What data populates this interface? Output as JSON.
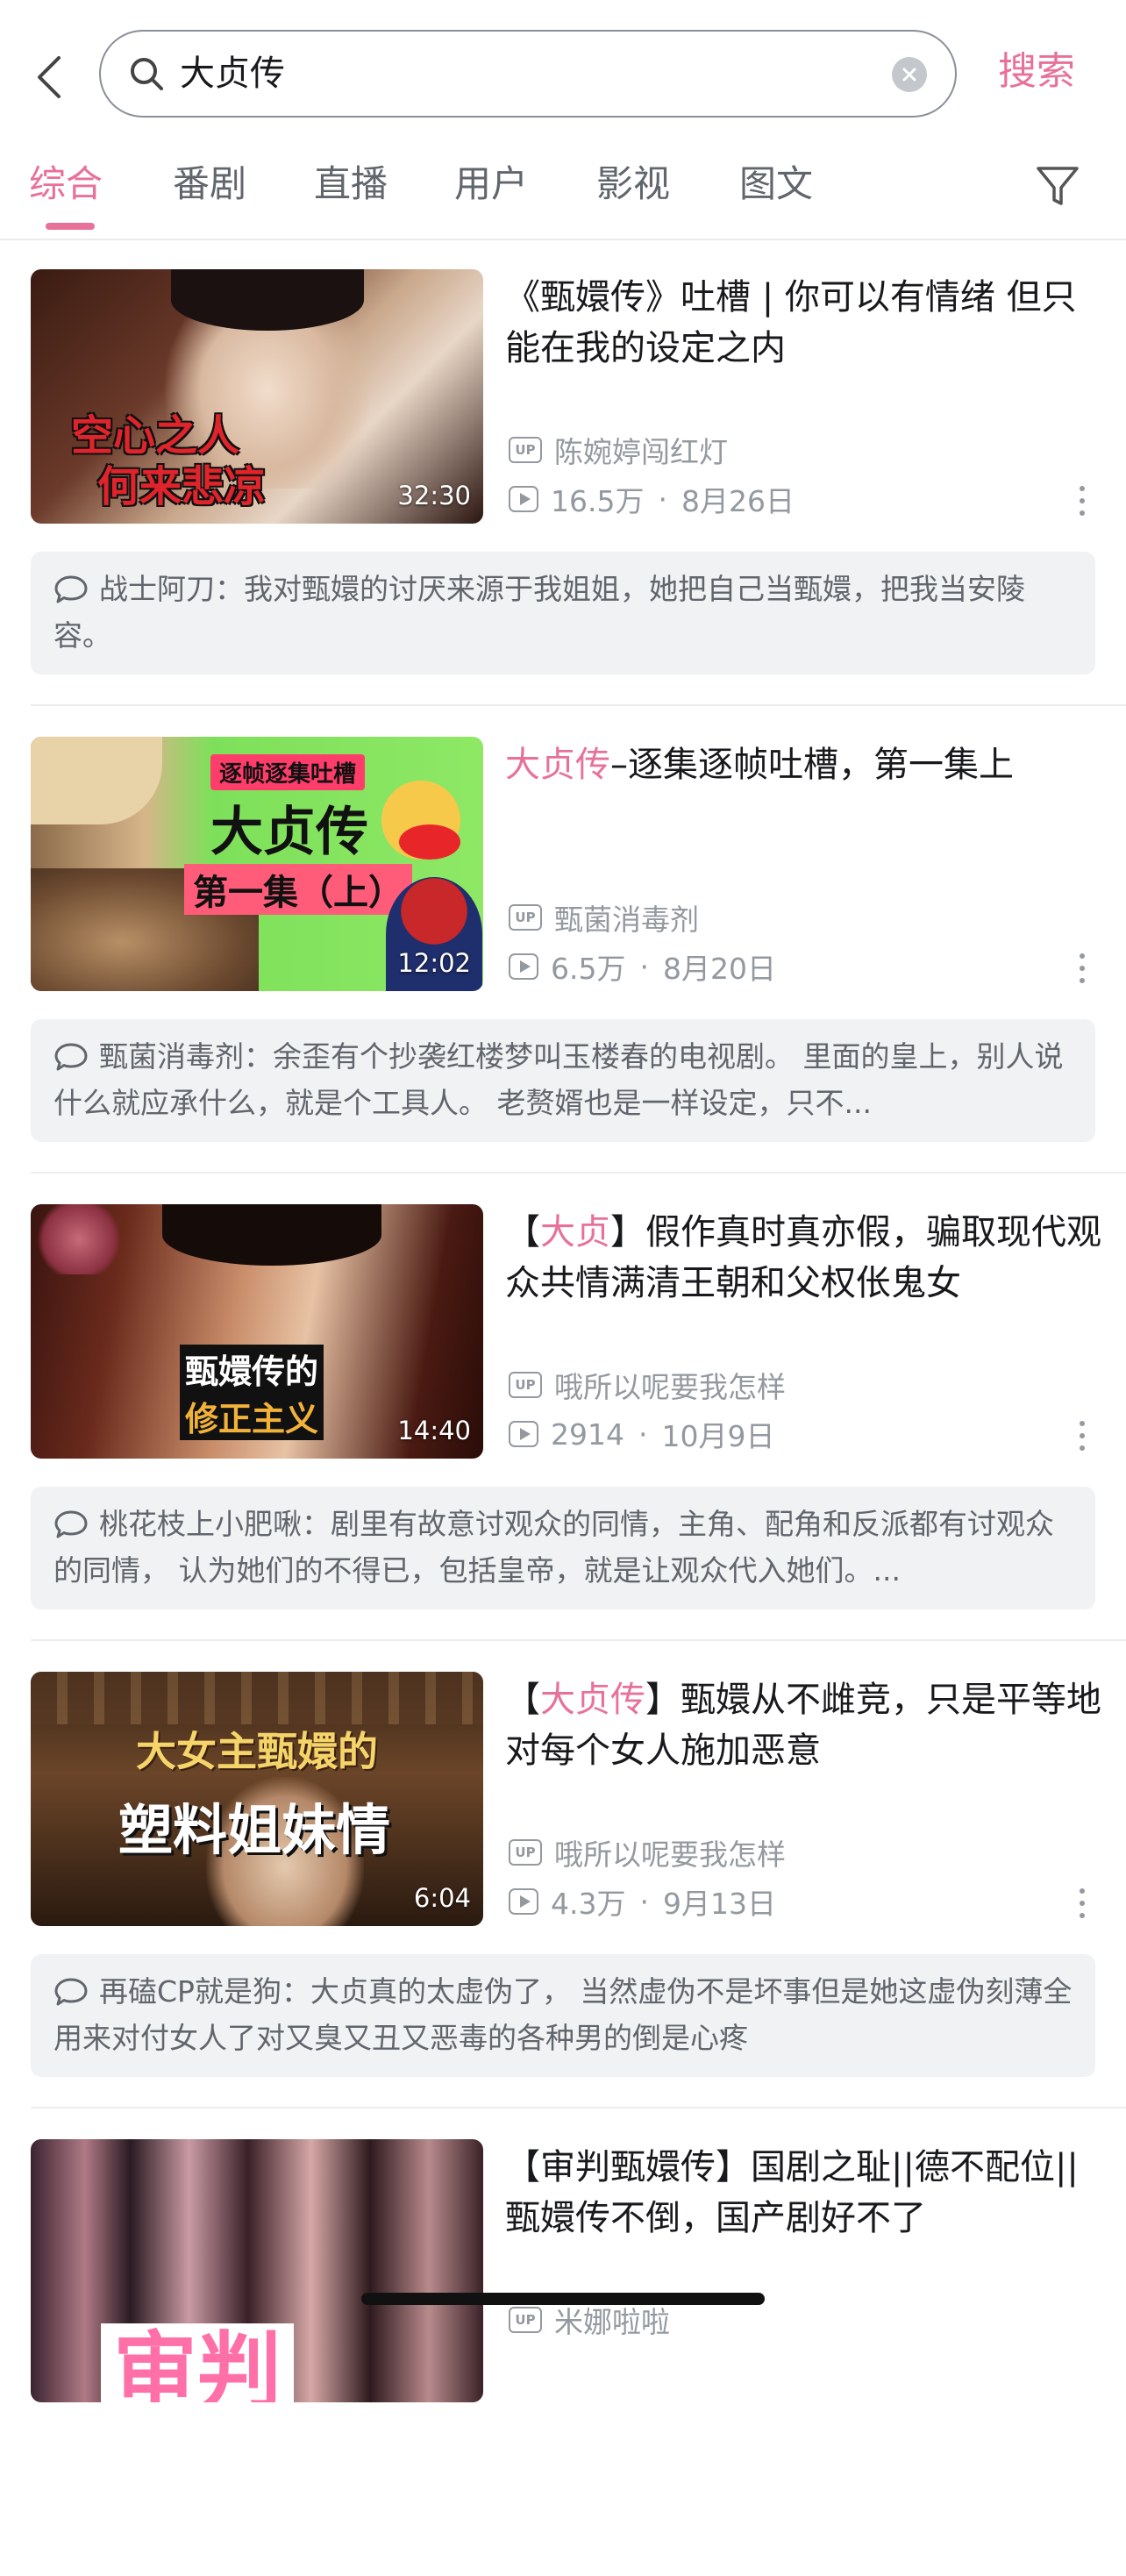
{
  "search": {
    "query": "大贞传",
    "search_button": "搜索"
  },
  "tabs": [
    {
      "label": "综合",
      "active": true
    },
    {
      "label": "番剧",
      "active": false
    },
    {
      "label": "直播",
      "active": false
    },
    {
      "label": "用户",
      "active": false
    },
    {
      "label": "影视",
      "active": false
    },
    {
      "label": "图文",
      "active": false
    }
  ],
  "colors": {
    "accent": "#e8719a",
    "text_secondary": "#9499a0",
    "comment_bg": "#f1f2f3"
  },
  "results": [
    {
      "title_prefix": "",
      "title_highlight": "",
      "title_suffix": "《甄嬛传》吐槽 | 你可以有情绪 但只能在我的设定之内",
      "thumb_text_1": "空心之人",
      "thumb_text_2": "何来悲凉",
      "duration": "32:30",
      "uploader": "陈婉婷闯红灯",
      "views": "16.5万",
      "date": "8月26日",
      "comment": "战士阿刀：我对甄嬛的讨厌来源于我姐姐，她把自己当甄嬛，把我当安陵容。"
    },
    {
      "title_prefix": "",
      "title_highlight": "大贞传",
      "title_suffix": "–逐集逐帧吐槽，第一集上",
      "thumb_text_1": "逐帧逐集吐槽",
      "thumb_text_2": "大贞传",
      "thumb_text_3": "第一集（上）",
      "duration": "12:02",
      "uploader": "甄菌消毒剂",
      "views": "6.5万",
      "date": "8月20日",
      "comment": "甄菌消毒剂：余歪有个抄袭红楼梦叫玉楼春的电视剧。 里面的皇上，别人说什么就应承什么，就是个工具人。 老赘婿也是一样设定，只不..."
    },
    {
      "title_prefix": "【",
      "title_highlight": "大贞",
      "title_suffix": "】假作真时真亦假，骗取现代观众共情满清王朝和父权伥鬼女",
      "thumb_text_1": "甄嬛传的",
      "thumb_text_2": "修正主义",
      "duration": "14:40",
      "uploader": "哦所以呢要我怎样",
      "views": "2914",
      "date": "10月9日",
      "comment": "桃花枝上小肥啾：剧里有故意讨观众的同情，主角、配角和反派都有讨观众的同情， 认为她们的不得已，包括皇帝，就是让观众代入她们。..."
    },
    {
      "title_prefix": "【",
      "title_highlight": "大贞传",
      "title_suffix": "】甄嬛从不雌竞，只是平等地对每个女人施加恶意",
      "thumb_text_1": "大女主甄嬛的",
      "thumb_text_2": "塑料姐妹情",
      "duration": "6:04",
      "uploader": "哦所以呢要我怎样",
      "views": "4.3万",
      "date": "9月13日",
      "comment": "再磕CP就是狗：大贞真的太虚伪了， 当然虚伪不是坏事但是她这虚伪刻薄全用来对付女人了对又臭又丑又恶毒的各种男的倒是心疼"
    },
    {
      "title_prefix": "",
      "title_highlight": "",
      "title_suffix": "【审判甄嬛传】国剧之耻||德不配位||甄嬛传不倒，国产剧好不了",
      "thumb_text_1": "审判",
      "uploader": "米娜啦啦",
      "views": "",
      "date": "",
      "comment": ""
    }
  ]
}
